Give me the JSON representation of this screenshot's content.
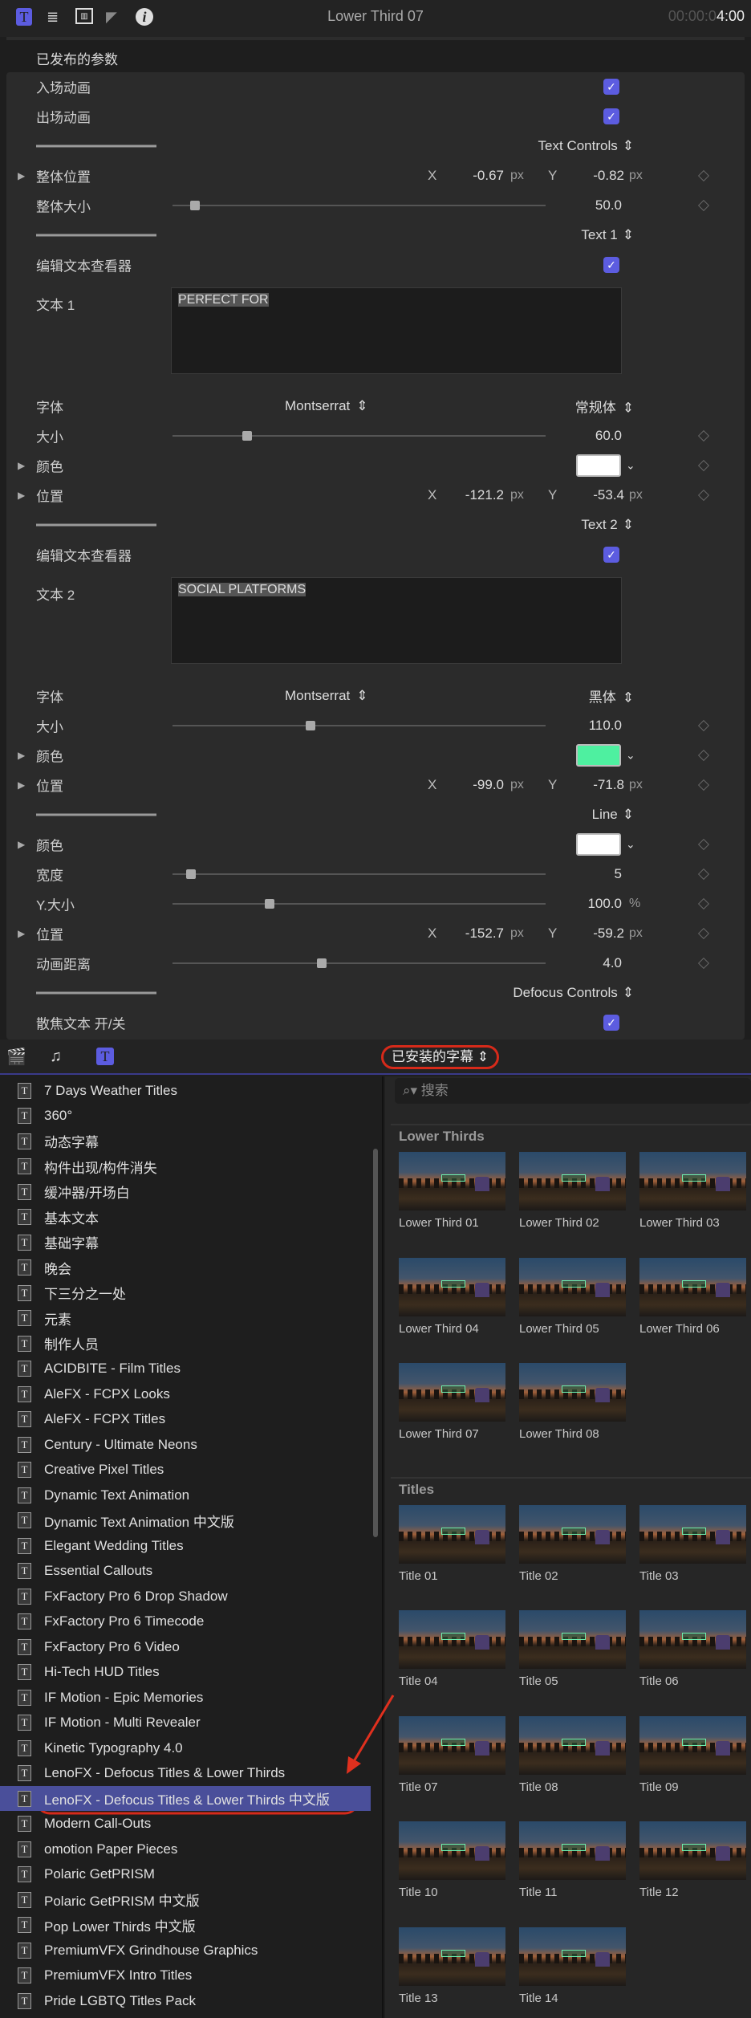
{
  "header": {
    "title": "Lower Third 07",
    "timecode_dim": "00:00:0",
    "timecode": "4:00",
    "icons": [
      "title-inspector-icon",
      "text-inspector-icon",
      "video-inspector-icon",
      "color-icon",
      "info-icon"
    ]
  },
  "inspector": {
    "heading": "已发布的参数",
    "rows": [
      {
        "type": "check",
        "label": "入场动画",
        "checked": true
      },
      {
        "type": "check",
        "label": "出场动画",
        "checked": true
      },
      {
        "type": "section",
        "label": "Text Controls"
      },
      {
        "type": "xy",
        "label": "整体位置",
        "expand": true,
        "x": "-0.67",
        "y": "-0.82",
        "unit": "px"
      },
      {
        "type": "slider",
        "label": "整体大小",
        "value": "50.0",
        "fraction": 0.06
      },
      {
        "type": "section",
        "label": "Text 1"
      },
      {
        "type": "check",
        "label": "编辑文本查看器",
        "checked": true
      },
      {
        "type": "textbox",
        "label": "文本 1",
        "text": "PERFECT FOR"
      },
      {
        "type": "font",
        "label": "字体",
        "font": "Montserrat",
        "style": "常规体"
      },
      {
        "type": "slider",
        "label": "大小",
        "value": "60.0",
        "fraction": 0.2
      },
      {
        "type": "color",
        "label": "颜色",
        "expand": true,
        "color": "#ffffff"
      },
      {
        "type": "xy",
        "label": "位置",
        "expand": true,
        "x": "-121.2",
        "y": "-53.4",
        "unit": "px"
      },
      {
        "type": "section",
        "label": "Text 2"
      },
      {
        "type": "check",
        "label": "编辑文本查看器",
        "checked": true
      },
      {
        "type": "textbox",
        "label": "文本 2",
        "text": "SOCIAL PLATFORMS"
      },
      {
        "type": "font",
        "label": "字体",
        "font": "Montserrat",
        "style": "黑体"
      },
      {
        "type": "slider",
        "label": "大小",
        "value": "110.0",
        "fraction": 0.37
      },
      {
        "type": "color",
        "label": "颜色",
        "expand": true,
        "color": "#4ef0a0"
      },
      {
        "type": "xy",
        "label": "位置",
        "expand": true,
        "x": "-99.0",
        "y": "-71.8",
        "unit": "px"
      },
      {
        "type": "section",
        "label": "Line"
      },
      {
        "type": "color",
        "label": "颜色",
        "expand": true,
        "color": "#ffffff"
      },
      {
        "type": "slider",
        "label": "宽度",
        "value": "5",
        "fraction": 0.05
      },
      {
        "type": "slider",
        "label": "Y.大小",
        "value": "100.0",
        "unit": "%",
        "fraction": 0.26
      },
      {
        "type": "xy",
        "label": "位置",
        "expand": true,
        "x": "-152.7",
        "y": "-59.2",
        "unit": "px"
      },
      {
        "type": "slider",
        "label": "动画距离",
        "value": "4.0",
        "fraction": 0.4
      },
      {
        "type": "section",
        "label": "Defocus Controls"
      },
      {
        "type": "check",
        "label": "散焦文本 开/关",
        "checked": true
      }
    ]
  },
  "browser": {
    "category": "已安装的字幕",
    "search_placeholder": "搜索",
    "selected_index": 28,
    "list": [
      "7 Days Weather Titles",
      "360°",
      "动态字幕",
      "构件出现/构件消失",
      "缓冲器/开场白",
      "基本文本",
      "基础字幕",
      "晚会",
      "下三分之一处",
      "元素",
      "制作人员",
      "ACIDBITE - Film Titles",
      "AleFX - FCPX Looks",
      "AleFX - FCPX Titles",
      "Century - Ultimate Neons",
      "Creative Pixel Titles",
      "Dynamic Text Animation",
      "Dynamic Text Animation 中文版",
      "Elegant Wedding Titles",
      "Essential Callouts",
      "FxFactory Pro 6 Drop Shadow",
      "FxFactory Pro 6 Timecode",
      "FxFactory Pro 6 Video",
      "Hi-Tech HUD Titles",
      "IF Motion - Epic Memories",
      "IF Motion - Multi Revealer",
      "Kinetic Typography 4.0",
      "LenoFX - Defocus Titles & Lower Thirds",
      "LenoFX - Defocus Titles & Lower Thirds 中文版",
      "Modern Call-Outs",
      "omotion Paper Pieces",
      "Polaric GetPRISM",
      "Polaric GetPRISM 中文版",
      "Pop Lower Thirds 中文版",
      "PremiumVFX Grindhouse Graphics",
      "PremiumVFX Intro Titles",
      "Pride LGBTQ Titles Pack"
    ],
    "sections": [
      {
        "title": "Lower Thirds",
        "items": [
          "Lower Third 01",
          "Lower Third 02",
          "Lower Third 03",
          "Lower Third 04",
          "Lower Third 05",
          "Lower Third 06",
          "Lower Third 07",
          "Lower Third 08"
        ]
      },
      {
        "title": "Titles",
        "items": [
          "Title 01",
          "Title 02",
          "Title 03",
          "Title 04",
          "Title 05",
          "Title 06",
          "Title 07",
          "Title 08",
          "Title 09",
          "Title 10",
          "Title 11",
          "Title 12",
          "Title 13",
          "Title 14"
        ]
      }
    ]
  },
  "colors": {
    "accent": "#5c5ce0",
    "selection": "#4a4f9a",
    "annotation": "#d62a1a"
  }
}
